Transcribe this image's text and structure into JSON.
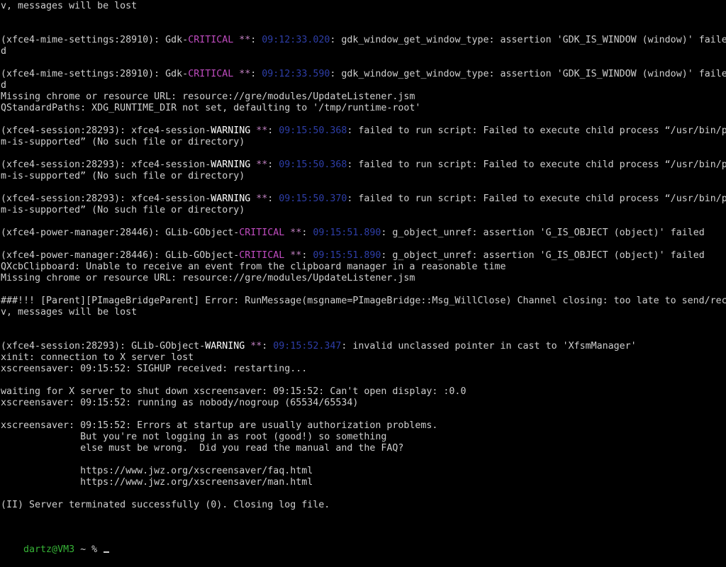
{
  "terminal": {
    "lines": [
      [
        {
          "t": "v, messages will be lost"
        }
      ],
      [],
      [],
      [
        {
          "t": "(xfce4-mime-settings:28910): Gdk-"
        },
        {
          "t": "CRITICAL",
          "c": "crit"
        },
        {
          "t": " "
        },
        {
          "t": "**",
          "c": "star"
        },
        {
          "t": ": "
        },
        {
          "t": "09:12:33.020",
          "c": "ts"
        },
        {
          "t": ": gdk_window_get_window_type: assertion 'GDK_IS_WINDOW (window)' failed"
        }
      ],
      [
        {
          "t": "d"
        }
      ],
      [],
      [
        {
          "t": "(xfce4-mime-settings:28910): Gdk-"
        },
        {
          "t": "CRITICAL",
          "c": "crit"
        },
        {
          "t": " "
        },
        {
          "t": "**",
          "c": "star"
        },
        {
          "t": ": "
        },
        {
          "t": "09:12:33.590",
          "c": "ts"
        },
        {
          "t": ": gdk_window_get_window_type: assertion 'GDK_IS_WINDOW (window)' failed"
        }
      ],
      [
        {
          "t": "d"
        }
      ],
      [
        {
          "t": "Missing chrome or resource URL: resource://gre/modules/UpdateListener.jsm"
        }
      ],
      [
        {
          "t": "QStandardPaths: XDG_RUNTIME_DIR not set, defaulting to '/tmp/runtime-root'"
        }
      ],
      [],
      [
        {
          "t": "(xfce4-session:28293): xfce4-session-"
        },
        {
          "t": "WARNING",
          "c": "warn"
        },
        {
          "t": " "
        },
        {
          "t": "**",
          "c": "star"
        },
        {
          "t": ": "
        },
        {
          "t": "09:15:50.368",
          "c": "ts"
        },
        {
          "t": ": failed to run script: Failed to execute child process “/usr/bin/p"
        }
      ],
      [
        {
          "t": "m-is-supported” (No such file or directory)"
        }
      ],
      [],
      [
        {
          "t": "(xfce4-session:28293): xfce4-session-"
        },
        {
          "t": "WARNING",
          "c": "warn"
        },
        {
          "t": " "
        },
        {
          "t": "**",
          "c": "star"
        },
        {
          "t": ": "
        },
        {
          "t": "09:15:50.368",
          "c": "ts"
        },
        {
          "t": ": failed to run script: Failed to execute child process “/usr/bin/p"
        }
      ],
      [
        {
          "t": "m-is-supported” (No such file or directory)"
        }
      ],
      [],
      [
        {
          "t": "(xfce4-session:28293): xfce4-session-"
        },
        {
          "t": "WARNING",
          "c": "warn"
        },
        {
          "t": " "
        },
        {
          "t": "**",
          "c": "star"
        },
        {
          "t": ": "
        },
        {
          "t": "09:15:50.370",
          "c": "ts"
        },
        {
          "t": ": failed to run script: Failed to execute child process “/usr/bin/p"
        }
      ],
      [
        {
          "t": "m-is-supported” (No such file or directory)"
        }
      ],
      [],
      [
        {
          "t": "(xfce4-power-manager:28446): GLib-GObject-"
        },
        {
          "t": "CRITICAL",
          "c": "crit"
        },
        {
          "t": " "
        },
        {
          "t": "**",
          "c": "star"
        },
        {
          "t": ": "
        },
        {
          "t": "09:15:51.890",
          "c": "ts"
        },
        {
          "t": ": g_object_unref: assertion 'G_IS_OBJECT (object)' failed"
        }
      ],
      [],
      [
        {
          "t": "(xfce4-power-manager:28446): GLib-GObject-"
        },
        {
          "t": "CRITICAL",
          "c": "crit"
        },
        {
          "t": " "
        },
        {
          "t": "**",
          "c": "star"
        },
        {
          "t": ": "
        },
        {
          "t": "09:15:51.890",
          "c": "ts"
        },
        {
          "t": ": g_object_unref: assertion 'G_IS_OBJECT (object)' failed"
        }
      ],
      [
        {
          "t": "QXcbClipboard: Unable to receive an event from the clipboard manager in a reasonable time"
        }
      ],
      [
        {
          "t": "Missing chrome or resource URL: resource://gre/modules/UpdateListener.jsm"
        }
      ],
      [],
      [
        {
          "t": "###!!! [Parent][PImageBridgeParent] Error: RunMessage(msgname=PImageBridge::Msg_WillClose) Channel closing: too late to send/rec"
        }
      ],
      [
        {
          "t": "v, messages will be lost"
        }
      ],
      [],
      [],
      [
        {
          "t": "(xfce4-session:28293): GLib-GObject-"
        },
        {
          "t": "WARNING",
          "c": "warn"
        },
        {
          "t": " "
        },
        {
          "t": "**",
          "c": "star"
        },
        {
          "t": ": "
        },
        {
          "t": "09:15:52.347",
          "c": "ts"
        },
        {
          "t": ": invalid unclassed pointer in cast to 'XfsmManager'"
        }
      ],
      [
        {
          "t": "xinit: connection to X server lost"
        }
      ],
      [
        {
          "t": "xscreensaver: 09:15:52: SIGHUP received: restarting..."
        }
      ],
      [],
      [
        {
          "t": "waiting for X server to shut down xscreensaver: 09:15:52: Can't open display: :0.0"
        }
      ],
      [
        {
          "t": "xscreensaver: 09:15:52: running as nobody/nogroup (65534/65534)"
        }
      ],
      [],
      [
        {
          "t": "xscreensaver: 09:15:52: Errors at startup are usually authorization problems."
        }
      ],
      [
        {
          "t": "              But you're not logging in as root (good!) so something"
        }
      ],
      [
        {
          "t": "              else must be wrong.  Did you read the manual and the FAQ?"
        }
      ],
      [],
      [
        {
          "t": "              https://www.jwz.org/xscreensaver/faq.html"
        }
      ],
      [
        {
          "t": "              https://www.jwz.org/xscreensaver/man.html"
        }
      ],
      [],
      [
        {
          "t": "(II) Server terminated successfully (0). Closing log file."
        }
      ]
    ],
    "prompt": {
      "user_host": "dartz@VM3",
      "rest": " ~ % "
    }
  }
}
